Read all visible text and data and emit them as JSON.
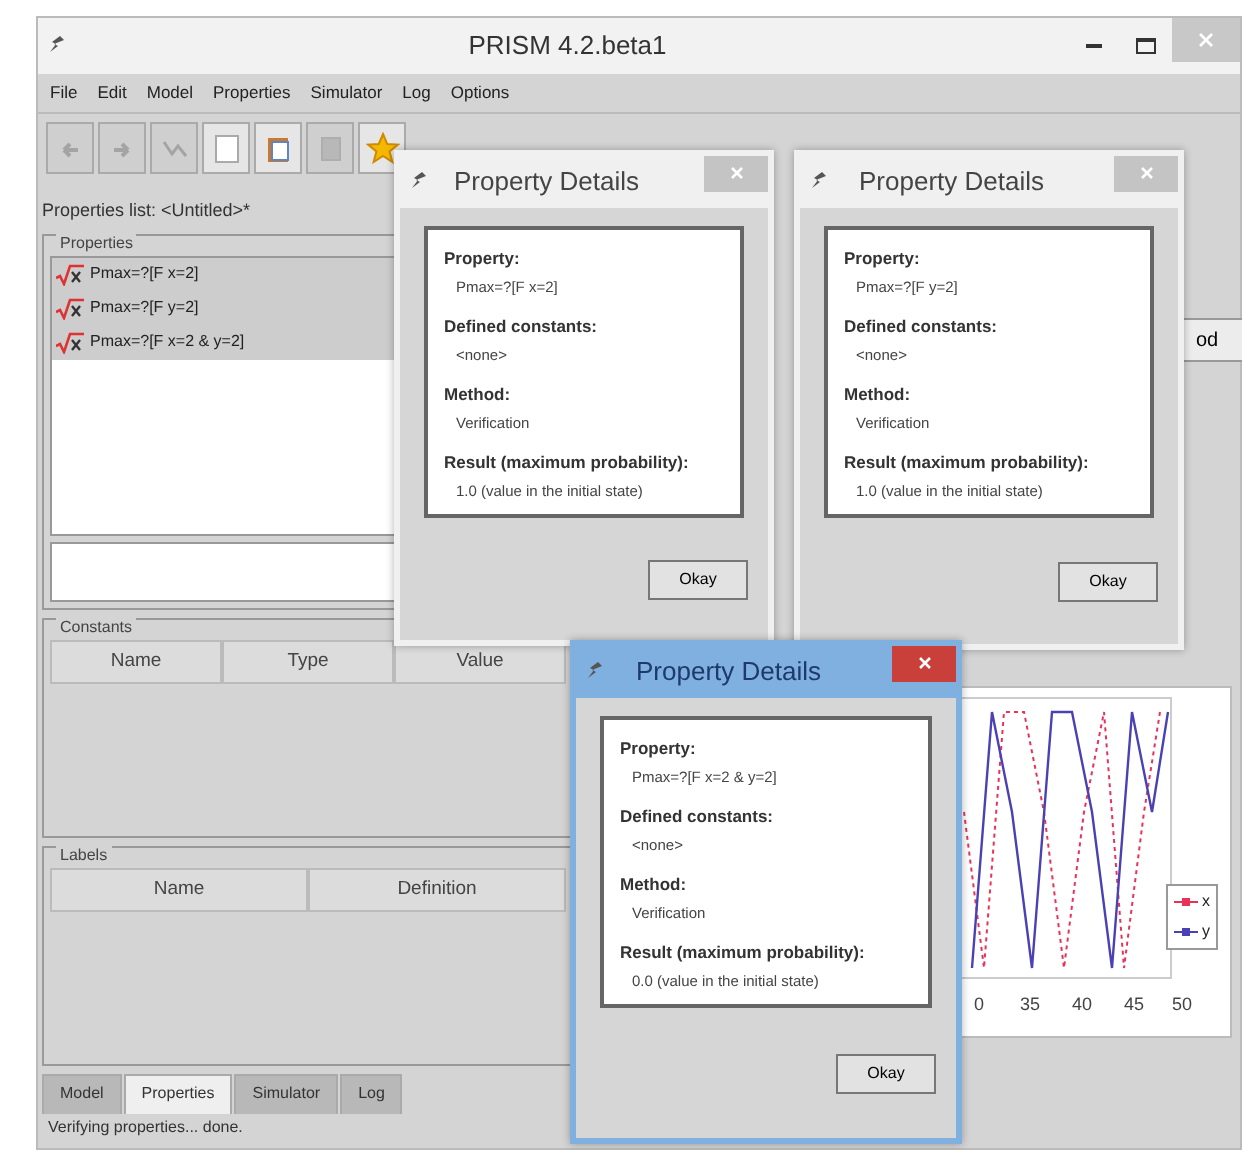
{
  "window": {
    "title": "PRISM 4.2.beta1"
  },
  "menu": [
    "File",
    "Edit",
    "Model",
    "Properties",
    "Simulator",
    "Log",
    "Options"
  ],
  "toolbar": [
    {
      "kind": "undo",
      "disabled": true
    },
    {
      "kind": "redo",
      "disabled": true
    },
    {
      "kind": "branch",
      "disabled": true
    },
    {
      "kind": "page",
      "disabled": false
    },
    {
      "kind": "clipboard",
      "disabled": false
    },
    {
      "kind": "square",
      "disabled": true
    },
    {
      "kind": "star",
      "disabled": false
    }
  ],
  "properties_title": "Properties list: <Untitled>*",
  "properties": {
    "title": "Properties",
    "items": [
      {
        "text": "Pmax=?[F x=2]",
        "selected": true
      },
      {
        "text": "Pmax=?[F y=2]",
        "selected": true
      },
      {
        "text": "Pmax=?[F x=2 & y=2]",
        "selected": true
      }
    ]
  },
  "constants": {
    "title": "Constants",
    "columns": [
      "Name",
      "Type",
      "Value"
    ]
  },
  "labels": {
    "title": "Labels",
    "columns": [
      "Name",
      "Definition"
    ]
  },
  "tabs": [
    {
      "label": "Model",
      "selected": false
    },
    {
      "label": "Properties",
      "selected": true
    },
    {
      "label": "Simulator",
      "selected": false
    },
    {
      "label": "Log",
      "selected": false
    }
  ],
  "status_bar": "Verifying properties... done.",
  "right_button": "od",
  "chart": {
    "x_tick_labels": [
      "0",
      "35",
      "40",
      "45",
      "50"
    ],
    "legend": [
      {
        "label": "x",
        "color": "#e8325a"
      },
      {
        "label": "y",
        "color": "#4a42b4"
      }
    ]
  },
  "dialogs": [
    {
      "title": "Property Details",
      "active": false,
      "fields": [
        {
          "label": "Property:",
          "value": "Pmax=?[F x=2]"
        },
        {
          "label": "Defined constants:",
          "value": "<none>"
        },
        {
          "label": "Method:",
          "value": "Verification"
        },
        {
          "label": "Result (maximum probability):",
          "value": "1.0 (value in the initial state)"
        }
      ],
      "button": "Okay"
    },
    {
      "title": "Property Details",
      "active": false,
      "fields": [
        {
          "label": "Property:",
          "value": "Pmax=?[F y=2]"
        },
        {
          "label": "Defined constants:",
          "value": "<none>"
        },
        {
          "label": "Method:",
          "value": "Verification"
        },
        {
          "label": "Result (maximum probability):",
          "value": "1.0 (value in the initial state)"
        }
      ],
      "button": "Okay"
    },
    {
      "title": "Property Details",
      "active": true,
      "fields": [
        {
          "label": "Property:",
          "value": "Pmax=?[F x=2 & y=2]"
        },
        {
          "label": "Defined constants:",
          "value": "<none>"
        },
        {
          "label": "Method:",
          "value": "Verification"
        },
        {
          "label": "Result (maximum probability):",
          "value": "0.0 (value in the initial state)"
        }
      ],
      "button": "Okay"
    }
  ]
}
